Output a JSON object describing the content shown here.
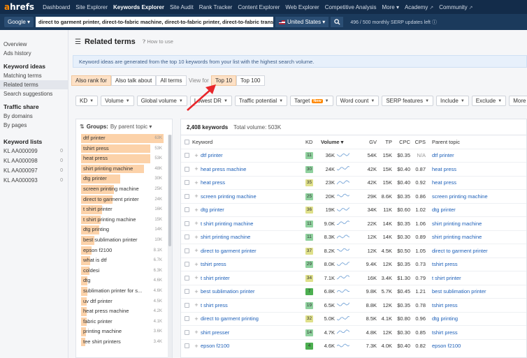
{
  "app": {
    "logo_a": "a",
    "logo_rest": "hrefs",
    "nav": [
      {
        "label": "Dashboard",
        "active": false,
        "ext": false
      },
      {
        "label": "Site Explorer",
        "active": false,
        "ext": false
      },
      {
        "label": "Keywords Explorer",
        "active": true,
        "ext": false
      },
      {
        "label": "Site Audit",
        "active": false,
        "ext": false
      },
      {
        "label": "Rank Tracker",
        "active": false,
        "ext": false
      },
      {
        "label": "Content Explorer",
        "active": false,
        "ext": false
      },
      {
        "label": "Web Explorer",
        "active": false,
        "ext": false
      },
      {
        "label": "Competitive Analysis",
        "active": false,
        "ext": false
      },
      {
        "label": "More ▾",
        "active": false,
        "ext": false
      },
      {
        "label": "Academy",
        "active": false,
        "ext": true
      },
      {
        "label": "Community",
        "active": false,
        "ext": true
      }
    ]
  },
  "search": {
    "engine": "Google ▾",
    "keywords": "direct to garment printer, direct-to-fabric machine, direct-to-fabric printer, direct-to-fabric transfer printi",
    "country": "United States ▾",
    "quota": "496 / 500  monthly SERP updates left"
  },
  "sidebar": {
    "top_links": [
      "Overview",
      "Ads history"
    ],
    "sections": [
      {
        "title": "Keyword ideas",
        "items": [
          "Matching terms",
          "Related terms",
          "Search suggestions"
        ],
        "active": "Related terms"
      },
      {
        "title": "Traffic share",
        "items": [
          "By domains",
          "By pages"
        ],
        "active": ""
      }
    ],
    "lists_title": "Keyword lists",
    "lists": [
      {
        "name": "KL AA000099",
        "count": "0"
      },
      {
        "name": "KL AA000098",
        "count": "0"
      },
      {
        "name": "KL AA000097",
        "count": "0"
      },
      {
        "name": "KL AA000093",
        "count": "0"
      }
    ]
  },
  "page": {
    "title": "Related terms",
    "howto": "How to use",
    "info": "Keyword ideas are generated from the top 10 keywords from your list with the highest search volume.",
    "mode_tabs": [
      {
        "label": "Also rank for",
        "on": true
      },
      {
        "label": "Also talk about",
        "on": false
      },
      {
        "label": "All terms",
        "on": false
      }
    ],
    "view_for": "View for",
    "view_tabs": [
      {
        "label": "Top 10",
        "on": true
      },
      {
        "label": "Top 100",
        "on": false
      }
    ],
    "filters": [
      {
        "label": "KD",
        "new": false
      },
      {
        "label": "Volume",
        "new": false
      },
      {
        "label": "Global volume",
        "new": false
      },
      {
        "label": "Lowest DR",
        "new": false
      },
      {
        "label": "Traffic potential",
        "new": false
      },
      {
        "label": "Target",
        "new": true
      },
      {
        "label": "Word count",
        "new": false
      },
      {
        "label": "SERP features",
        "new": false
      },
      {
        "label": "Include",
        "new": false
      },
      {
        "label": "Exclude",
        "new": false
      },
      {
        "label": "More filters",
        "new": false
      }
    ],
    "new_badge": "New"
  },
  "groups": {
    "label": "Groups:",
    "sort": "By parent topic ▾",
    "max": 63,
    "items": [
      {
        "name": "dtf printer",
        "count": "63K",
        "value": 63
      },
      {
        "name": "tshirt press",
        "count": "53K",
        "value": 53
      },
      {
        "name": "heat press",
        "count": "53K",
        "value": 53
      },
      {
        "name": "shirt printing machine",
        "count": "48K",
        "value": 48
      },
      {
        "name": "dtg printer",
        "count": "30K",
        "value": 30
      },
      {
        "name": "screen printing machine",
        "count": "25K",
        "value": 25
      },
      {
        "name": "direct to garment printer",
        "count": "24K",
        "value": 24
      },
      {
        "name": "t shirt printer",
        "count": "16K",
        "value": 16
      },
      {
        "name": "t shirt printing machine",
        "count": "15K",
        "value": 15
      },
      {
        "name": "dtg printing",
        "count": "14K",
        "value": 14
      },
      {
        "name": "best sublimation printer",
        "count": "10K",
        "value": 10
      },
      {
        "name": "epson f2100",
        "count": "8.1K",
        "value": 8.1
      },
      {
        "name": "what is dtf",
        "count": "6.7K",
        "value": 6.7
      },
      {
        "name": "coldesi",
        "count": "6.3K",
        "value": 6.3
      },
      {
        "name": "dtg",
        "count": "4.6K",
        "value": 4.6
      },
      {
        "name": "sublimation printer for s...",
        "count": "4.6K",
        "value": 4.6
      },
      {
        "name": "uv dtf printer",
        "count": "4.5K",
        "value": 4.5
      },
      {
        "name": "heat press machine",
        "count": "4.2K",
        "value": 4.2
      },
      {
        "name": "fabric printer",
        "count": "4.1K",
        "value": 4.1
      },
      {
        "name": "printing machine",
        "count": "3.6K",
        "value": 3.6
      },
      {
        "name": "tee shirt printers",
        "count": "3.4K",
        "value": 3.4
      }
    ]
  },
  "keywords": {
    "total": "2,408 keywords",
    "total_volume": "Total volume: 503K",
    "headers": {
      "keyword": "Keyword",
      "kd": "KD",
      "volume": "Volume ▾",
      "gv": "GV",
      "tp": "TP",
      "cpc": "CPC",
      "cps": "CPS",
      "parent": "Parent topic"
    },
    "rows": [
      {
        "kw": "dtf printer",
        "kd": "11",
        "vol": "36K",
        "gv": "54K",
        "tp": "15K",
        "cpc": "$0.35",
        "cps": "N/A",
        "parent": "dtf printer"
      },
      {
        "kw": "heat press machine",
        "kd": "30",
        "vol": "24K",
        "gv": "42K",
        "tp": "15K",
        "cpc": "$0.40",
        "cps": "0.87",
        "parent": "heat press"
      },
      {
        "kw": "heat press",
        "kd": "35",
        "vol": "23K",
        "gv": "42K",
        "tp": "15K",
        "cpc": "$0.40",
        "cps": "0.92",
        "parent": "heat press"
      },
      {
        "kw": "screen printing machine",
        "kd": "25",
        "vol": "20K",
        "gv": "29K",
        "tp": "8.6K",
        "cpc": "$0.35",
        "cps": "0.86",
        "parent": "screen printing machine"
      },
      {
        "kw": "dtg printer",
        "kd": "36",
        "vol": "19K",
        "gv": "34K",
        "tp": "11K",
        "cpc": "$0.60",
        "cps": "1.02",
        "parent": "dtg printer"
      },
      {
        "kw": "t shirt printing machine",
        "kd": "11",
        "vol": "9.0K",
        "gv": "22K",
        "tp": "14K",
        "cpc": "$0.35",
        "cps": "1.06",
        "parent": "shirt printing machine"
      },
      {
        "kw": "shirt printing machine",
        "kd": "11",
        "vol": "8.3K",
        "gv": "12K",
        "tp": "14K",
        "cpc": "$0.30",
        "cps": "0.89",
        "parent": "shirt printing machine"
      },
      {
        "kw": "direct to garment printer",
        "kd": "37",
        "vol": "8.2K",
        "gv": "12K",
        "tp": "4.5K",
        "cpc": "$0.50",
        "cps": "1.05",
        "parent": "direct to garment printer"
      },
      {
        "kw": "tshirt press",
        "kd": "29",
        "vol": "8.0K",
        "gv": "9.4K",
        "tp": "12K",
        "cpc": "$0.35",
        "cps": "0.73",
        "parent": "tshirt press"
      },
      {
        "kw": "t shirt printer",
        "kd": "34",
        "vol": "7.1K",
        "gv": "16K",
        "tp": "3.4K",
        "cpc": "$1.30",
        "cps": "0.79",
        "parent": "t shirt printer"
      },
      {
        "kw": "best sublimation printer",
        "kd": "7",
        "vol": "6.8K",
        "gv": "9.8K",
        "tp": "5.7K",
        "cpc": "$0.45",
        "cps": "1.21",
        "parent": "best sublimation printer"
      },
      {
        "kw": "t shirt press",
        "kd": "19",
        "vol": "6.5K",
        "gv": "8.8K",
        "tp": "12K",
        "cpc": "$0.35",
        "cps": "0.78",
        "parent": "tshirt press"
      },
      {
        "kw": "direct to garment printing",
        "kd": "32",
        "vol": "5.0K",
        "gv": "8.5K",
        "tp": "4.1K",
        "cpc": "$0.80",
        "cps": "0.96",
        "parent": "dtg printing"
      },
      {
        "kw": "shirt presser",
        "kd": "14",
        "vol": "4.7K",
        "gv": "4.8K",
        "tp": "12K",
        "cpc": "$0.30",
        "cps": "0.85",
        "parent": "tshirt press"
      },
      {
        "kw": "epson f2100",
        "kd": "4",
        "vol": "4.6K",
        "gv": "7.3K",
        "tp": "4.0K",
        "cpc": "$0.40",
        "cps": "0.82",
        "parent": "epson f2100"
      }
    ]
  },
  "colors": {
    "nav_bg": "#132c4a",
    "accent": "#ff8800",
    "bar": "#fcd2a9",
    "link": "#1c5fb8",
    "arrow": "#e8262b",
    "kd_easy": "#8fd19e",
    "kd_medium": "#dfe08a",
    "kd_green": "#4caf50",
    "spark": "#7aa7d8"
  }
}
